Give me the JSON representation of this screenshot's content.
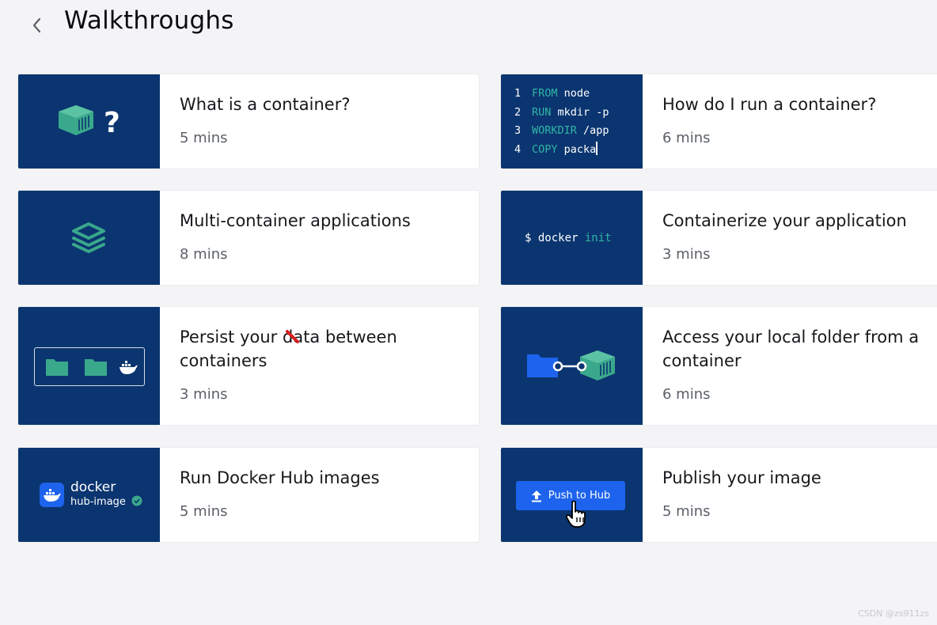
{
  "header": {
    "title": "Walkthroughs"
  },
  "walkthroughs": [
    {
      "title": "What is a container?",
      "duration": "5 mins"
    },
    {
      "title": "How do I run a container?",
      "duration": "6 mins",
      "code": [
        {
          "num": "1",
          "kw": "FROM",
          "arg": "node"
        },
        {
          "num": "2",
          "kw": "RUN",
          "arg": "mkdir -p"
        },
        {
          "num": "3",
          "kw": "WORKDIR",
          "arg": "/app"
        },
        {
          "num": "4",
          "kw": "COPY",
          "arg": "packa"
        }
      ]
    },
    {
      "title": "Multi-container applications",
      "duration": "8 mins"
    },
    {
      "title": "Containerize your application",
      "duration": "3 mins",
      "command": {
        "prompt": "$ docker",
        "arg": "init"
      }
    },
    {
      "title": "Persist your data between containers",
      "duration": "3 mins"
    },
    {
      "title": "Access your local folder from a container",
      "duration": "6 mins"
    },
    {
      "title": "Run Docker Hub images",
      "duration": "5 mins",
      "hub": {
        "name": "docker",
        "sub": "hub-image"
      }
    },
    {
      "title": "Publish your image",
      "duration": "5 mins",
      "button": "Push to Hub"
    }
  ],
  "watermark": "CSDN @zs911zs",
  "colors": {
    "thumb_bg": "#0b3570",
    "accent_teal": "#3aa88b",
    "docker_blue": "#1d63ed"
  }
}
